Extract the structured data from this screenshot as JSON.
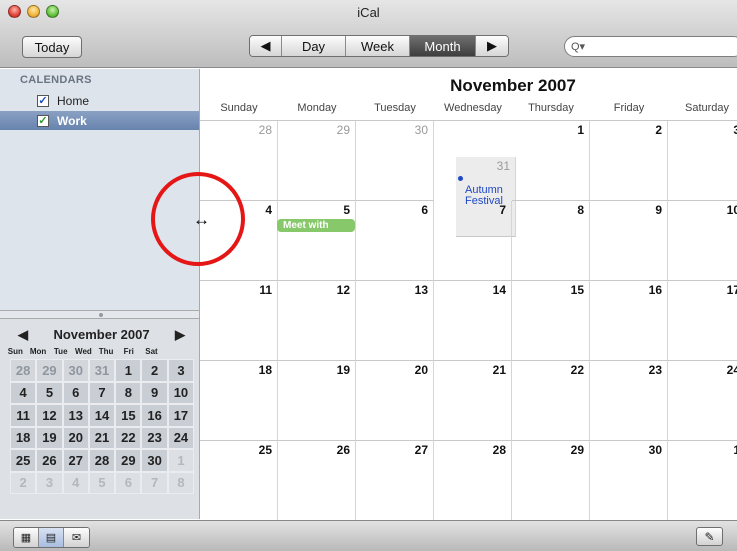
{
  "window": {
    "title": "iCal"
  },
  "toolbar": {
    "today_label": "Today",
    "prev_label": "◀",
    "next_label": "▶",
    "views": [
      "Day",
      "Week",
      "Month"
    ],
    "selected_view": "Month",
    "search_placeholder": "Q▾"
  },
  "sidebar": {
    "heading": "CALENDARS",
    "calendars": [
      {
        "label": "Home",
        "checked": true,
        "color": "#1a4cc1"
      },
      {
        "label": "Work",
        "checked": true,
        "color": "#2a9a2a",
        "selected": true
      }
    ]
  },
  "mini_calendar": {
    "title": "November 2007",
    "prev": "◀",
    "next": "▶",
    "weekdays": [
      "Sun",
      "Mon",
      "Tue",
      "Wed",
      "Thu",
      "Fri",
      "Sat"
    ],
    "days": [
      "28",
      "29",
      "30",
      "31",
      "1",
      "2",
      "3",
      "4",
      "5",
      "6",
      "7",
      "8",
      "9",
      "10",
      "11",
      "12",
      "13",
      "14",
      "15",
      "16",
      "17",
      "18",
      "19",
      "20",
      "21",
      "22",
      "23",
      "24",
      "25",
      "26",
      "27",
      "28",
      "29",
      "30",
      "1",
      "2",
      "3",
      "4",
      "5",
      "6",
      "7",
      "8"
    ]
  },
  "month_view": {
    "title": "November 2007",
    "weekdays": [
      "Sunday",
      "Monday",
      "Tuesday",
      "Wednesday",
      "Thursday",
      "Friday",
      "Saturday"
    ],
    "days": [
      "28",
      "29",
      "30",
      "31",
      "1",
      "2",
      "3",
      "4",
      "5",
      "6",
      "7",
      "8",
      "9",
      "10",
      "11",
      "12",
      "13",
      "14",
      "15",
      "16",
      "17",
      "18",
      "19",
      "20",
      "21",
      "22",
      "23",
      "24",
      "25",
      "26",
      "27",
      "28",
      "29",
      "30",
      "1"
    ],
    "events": [
      {
        "day": "31",
        "title": "Autumn Festival",
        "color": "#1f48c4"
      },
      {
        "day": "5",
        "title": "Meet with",
        "color": "#86c86a"
      }
    ]
  },
  "bottom_bar": {
    "icons": [
      "calendars-icon",
      "month-icon",
      "mail-icon"
    ],
    "pin_icon": "pin-icon"
  },
  "highlight_color": "#e41616"
}
